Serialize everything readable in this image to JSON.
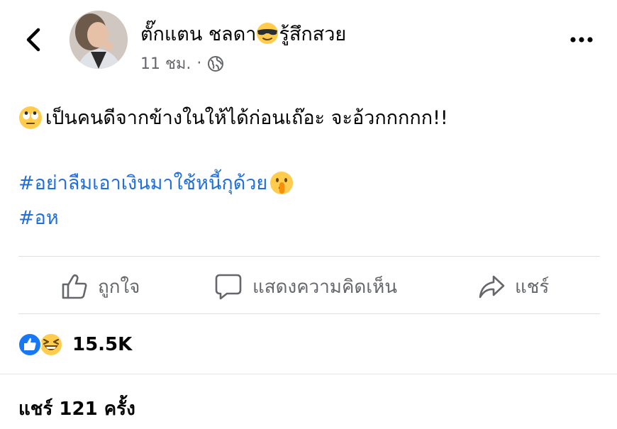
{
  "post": {
    "author": "ตั๊กแตน ชลดา",
    "author_suffix": "รู้สึกสวย",
    "time": "11 ชม.",
    "separator": "·",
    "text": "เป็นคนดีจากข้างในให้ได้ก่อนเถ๊อะ จะอ้วกกกกก!!",
    "hashtags": [
      "#อย่าลืมเอาเงินมาใช้หนี้กุด้วย",
      "#อห"
    ]
  },
  "actions": {
    "like": "ถูกใจ",
    "comment": "แสดงความคิดเห็น",
    "share": "แชร์"
  },
  "reactions": {
    "count": "15.5K"
  },
  "shares": {
    "text": "แชร์ 121 ครั้ง"
  },
  "icons": {
    "back": "chevron-left-icon",
    "more": "more-dots-icon",
    "privacy": "globe-icon",
    "author_emoji": "smiling-face-with-sunglasses-emoji",
    "text_emoji": "face-with-rolling-eyes-emoji",
    "hashtag_emoji": "shushing-face-emoji",
    "like": "thumbs-up-icon",
    "comment": "comment-bubble-icon",
    "share": "share-arrow-icon",
    "reaction_like": "like-reaction-icon",
    "reaction_haha": "haha-reaction-icon"
  },
  "colors": {
    "link": "#216fdb",
    "secondary_text": "#65676b",
    "like_blue": "#1877f2",
    "emoji_yellow": "#ffcc4d"
  }
}
